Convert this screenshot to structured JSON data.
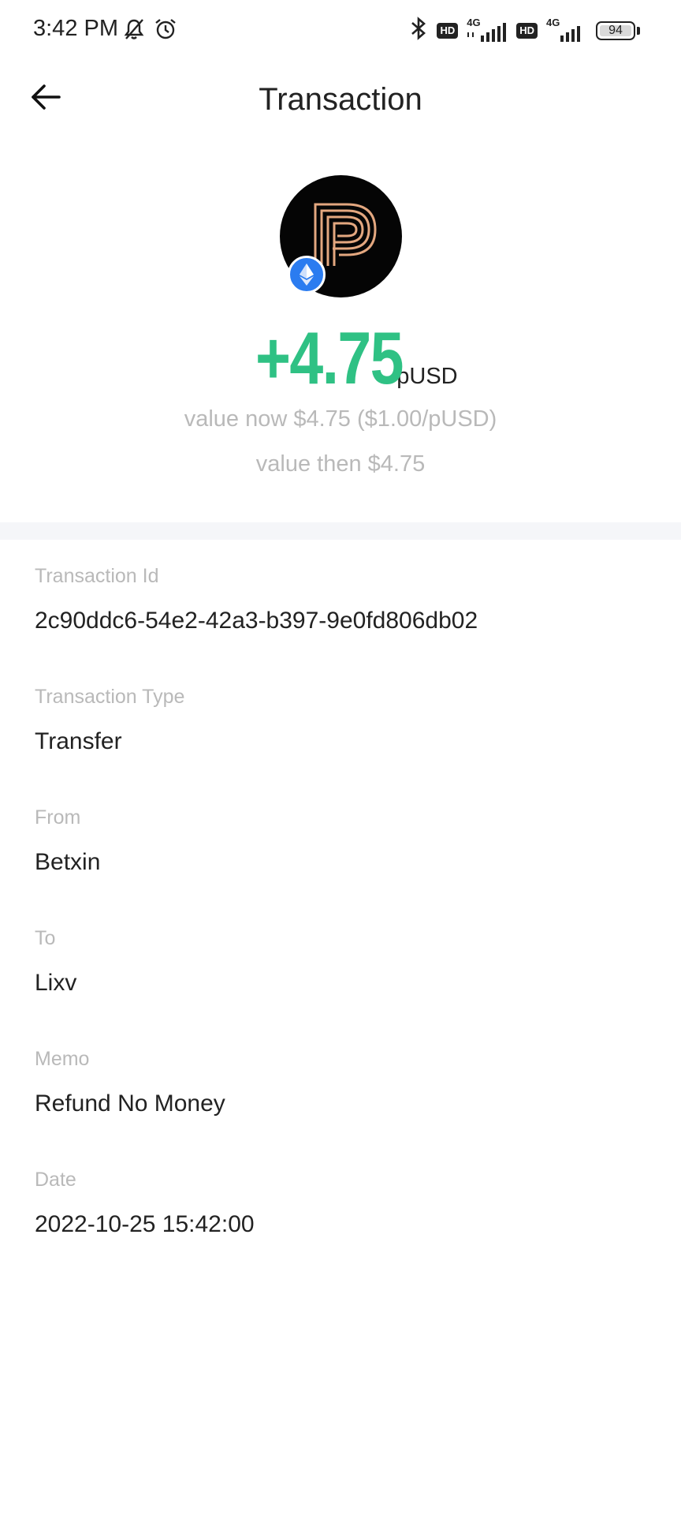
{
  "status_bar": {
    "time": "3:42 PM",
    "left_icons": [
      "bell-muted-icon",
      "alarm-icon"
    ],
    "right_icons": [
      "bluetooth-icon",
      "hd-icon",
      "signal-4g-icon",
      "hd-icon",
      "signal-4g-icon",
      "battery-icon"
    ],
    "hd_label": "HD",
    "network_label": "4G",
    "battery_level": "94"
  },
  "header": {
    "title": "Transaction",
    "back_icon": "arrow-left-icon"
  },
  "asset": {
    "icon": "pusd-logo-icon",
    "chain_icon": "ethereum-icon",
    "amount": "+4.75",
    "symbol": "pUSD",
    "value_now": "value now $4.75 ($1.00/pUSD)",
    "value_then": "value then $4.75"
  },
  "details": [
    {
      "label": "Transaction Id",
      "value": "2c90ddc6-54e2-42a3-b397-9e0fd806db02"
    },
    {
      "label": "Transaction Type",
      "value": "Transfer"
    },
    {
      "label": "From",
      "value": "Betxin"
    },
    {
      "label": "To",
      "value": "Lixv"
    },
    {
      "label": "Memo",
      "value": "Refund No Money"
    },
    {
      "label": "Date",
      "value": "2022-10-25 15:42:00"
    }
  ],
  "colors": {
    "amount_positive": "#2fc184",
    "label_gray": "#b9b9b9",
    "chain_badge_blue": "#2b7cf0",
    "divider_band": "#f5f6f9",
    "logo_gold": "#e3a77f"
  }
}
